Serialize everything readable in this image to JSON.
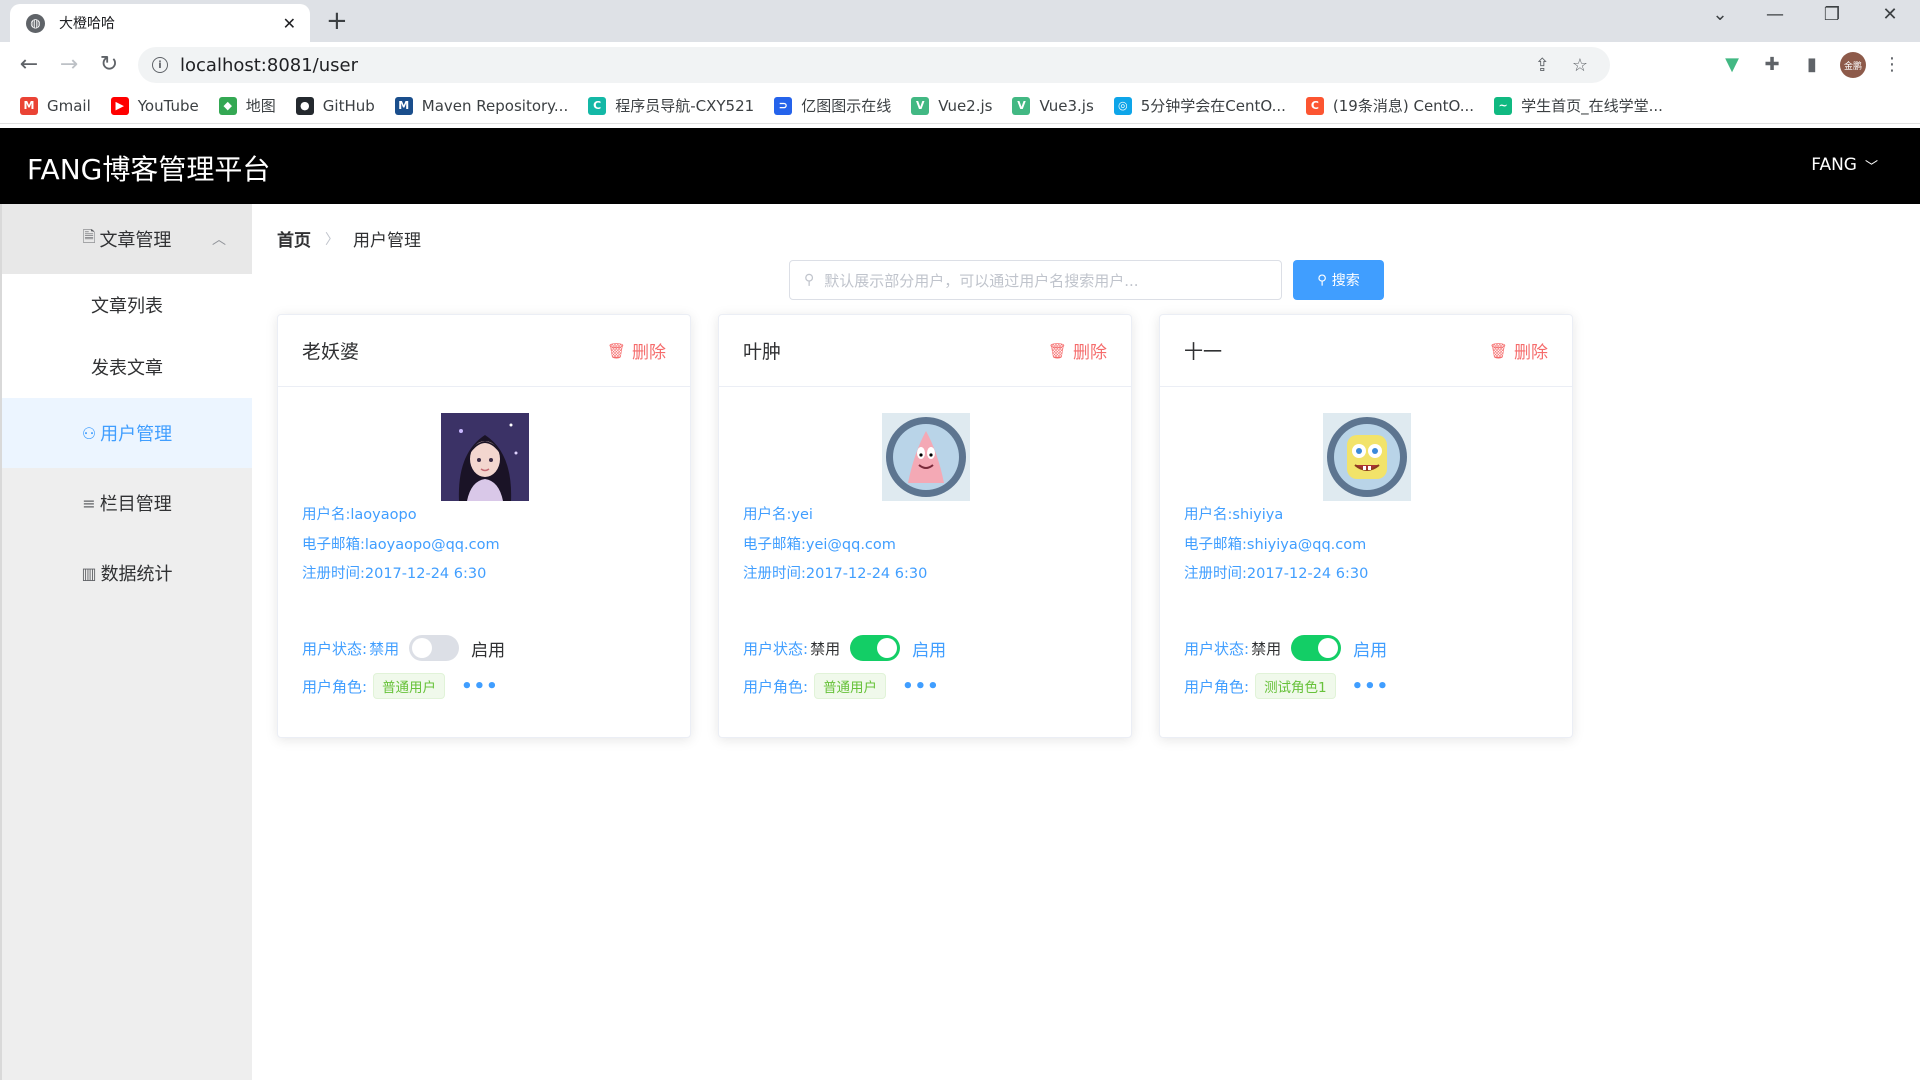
{
  "browser": {
    "tab_title": "大橙哈哈",
    "url": "localhost:8081/user",
    "profile_label": "金鹏",
    "bookmarks": [
      {
        "label": "Gmail",
        "color": "#ea4335",
        "glyph": "M"
      },
      {
        "label": "YouTube",
        "color": "#ff0000",
        "glyph": "▶"
      },
      {
        "label": "地图",
        "color": "#34a853",
        "glyph": "◆"
      },
      {
        "label": "GitHub",
        "color": "#24292e",
        "glyph": "●"
      },
      {
        "label": "Maven Repository...",
        "color": "#1a4e8c",
        "glyph": "M"
      },
      {
        "label": "程序员导航-CXY521",
        "color": "#14b8a6",
        "glyph": "C"
      },
      {
        "label": "亿图图示在线",
        "color": "#2563eb",
        "glyph": "⊃"
      },
      {
        "label": "Vue2.js",
        "color": "#42b883",
        "glyph": "V"
      },
      {
        "label": "Vue3.js",
        "color": "#42b883",
        "glyph": "V"
      },
      {
        "label": "5分钟学会在CentO...",
        "color": "#0ea5e9",
        "glyph": "◎"
      },
      {
        "label": "(19条消息) CentO...",
        "color": "#fc5531",
        "glyph": "C"
      },
      {
        "label": "学生首页_在线学堂...",
        "color": "#10b981",
        "glyph": "~"
      }
    ]
  },
  "header": {
    "title": "FANG博客管理平台",
    "user_label": "FANG"
  },
  "sidebar": {
    "group_label": "文章管理",
    "sub_items": [
      "文章列表",
      "发表文章"
    ],
    "items": [
      {
        "label": "用户管理",
        "active": true
      },
      {
        "label": "栏目管理",
        "active": false
      },
      {
        "label": "数据统计",
        "active": false
      }
    ]
  },
  "breadcrumb": {
    "home": "首页",
    "current": "用户管理"
  },
  "search": {
    "placeholder": "默认展示部分用户，可以通过用户名搜索用户...",
    "button_label": "搜索"
  },
  "cards": [
    {
      "name": "老妖婆",
      "delete_label": "删除",
      "username": "用户名:laoyaopo",
      "email": "电子邮箱:laoyaopo@qq.com",
      "registered": "注册时间:2017-12-24 6:30",
      "status_label": "用户状态:",
      "status_off": "禁用",
      "status_on": "启用",
      "enabled": false,
      "role_label": "用户角色:",
      "role": "普通用户",
      "avatar": "girl"
    },
    {
      "name": "叶肿",
      "delete_label": "删除",
      "username": "用户名:yei",
      "email": "电子邮箱:yei@qq.com",
      "registered": "注册时间:2017-12-24 6:30",
      "status_label": "用户状态:",
      "status_off": "禁用",
      "status_on": "启用",
      "enabled": true,
      "role_label": "用户角色:",
      "role": "普通用户",
      "avatar": "patrick"
    },
    {
      "name": "十一",
      "delete_label": "删除",
      "username": "用户名:shiyiya",
      "email": "电子邮箱:shiyiya@qq.com",
      "registered": "注册时间:2017-12-24 6:30",
      "status_label": "用户状态:",
      "status_off": "禁用",
      "status_on": "启用",
      "enabled": true,
      "role_label": "用户角色:",
      "role": "测试角色1",
      "avatar": "spongebob"
    }
  ],
  "colors": {
    "primary": "#409eff",
    "danger": "#f56c6c",
    "success": "#13ce66",
    "switch_off": "#dcdfe6"
  }
}
